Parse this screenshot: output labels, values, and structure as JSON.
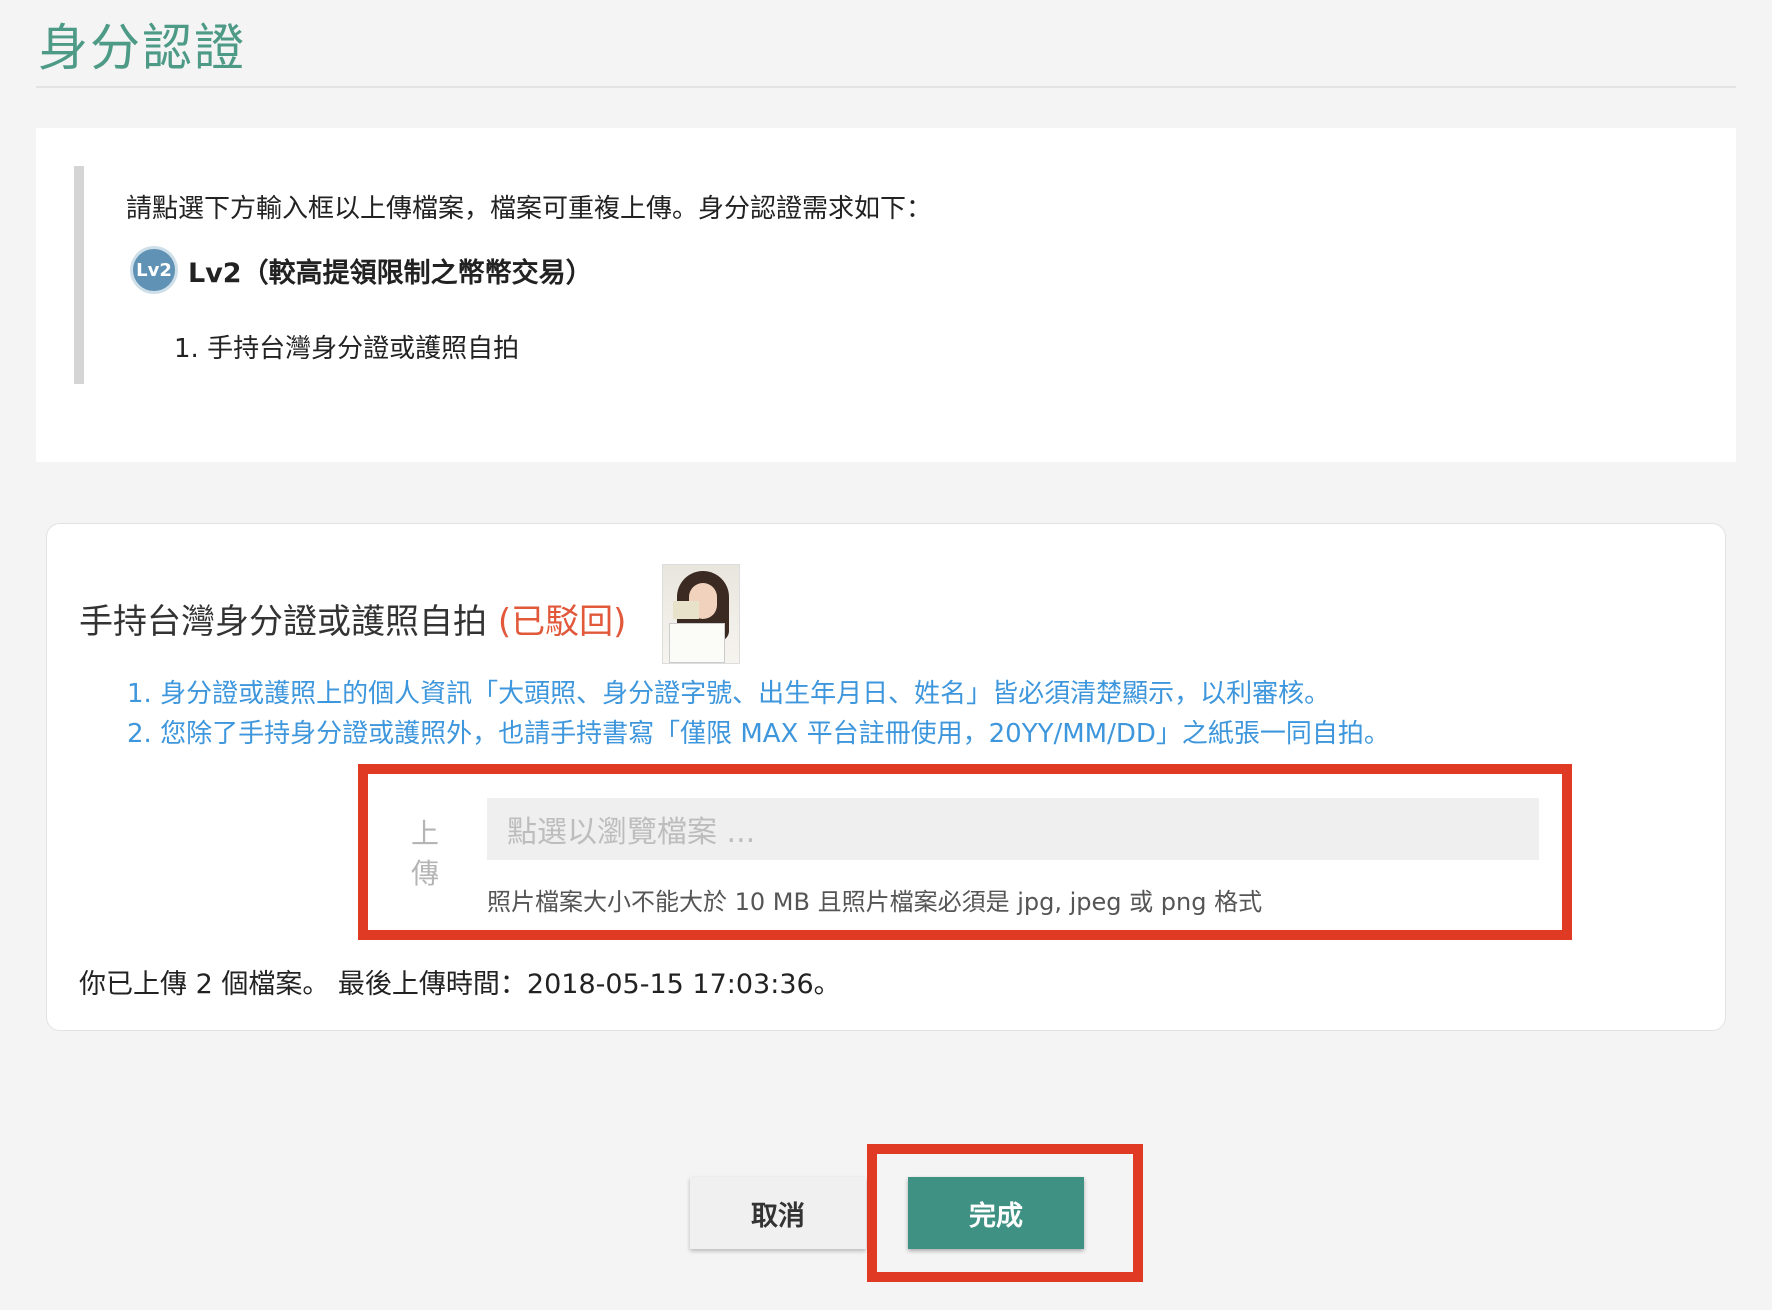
{
  "page": {
    "title": "身分認證"
  },
  "info": {
    "instruction": "請點選下方輸入框以上傳檔案，檔案可重複上傳。身分認證需求如下：",
    "level_badge": "Lv2",
    "level_title": "Lv2（較高提領限制之幣幣交易）",
    "requirements": [
      "1. 手持台灣身分證或護照自拍"
    ]
  },
  "upload_card": {
    "title": "手持台灣身分證或護照自拍",
    "status": "(已駁回)",
    "tips": [
      "1. 身分證或護照上的個人資訊「大頭照、身分證字號、出生年月日、姓名」皆必須清楚顯示，以利審核。",
      "2. 您除了手持身分證或護照外，也請手持書寫「僅限 MAX 平台註冊使用，20YY/MM/DD」之紙張一同自拍。"
    ],
    "upload_label": "上傳",
    "upload_placeholder": "點選以瀏覽檔案 ...",
    "upload_hint": "照片檔案大小不能大於 10 MB 且照片檔案必須是 jpg, jpeg 或 png 格式",
    "upload_status": "你已上傳 2 個檔案。 最後上傳時間：2018-05-15 17:03:36。"
  },
  "buttons": {
    "cancel": "取消",
    "done": "完成"
  },
  "colors": {
    "accent": "#3f9283",
    "title": "#4d9a86",
    "rejected": "#e2583a",
    "tips": "#3e97dc",
    "highlight": "#e03a24"
  }
}
